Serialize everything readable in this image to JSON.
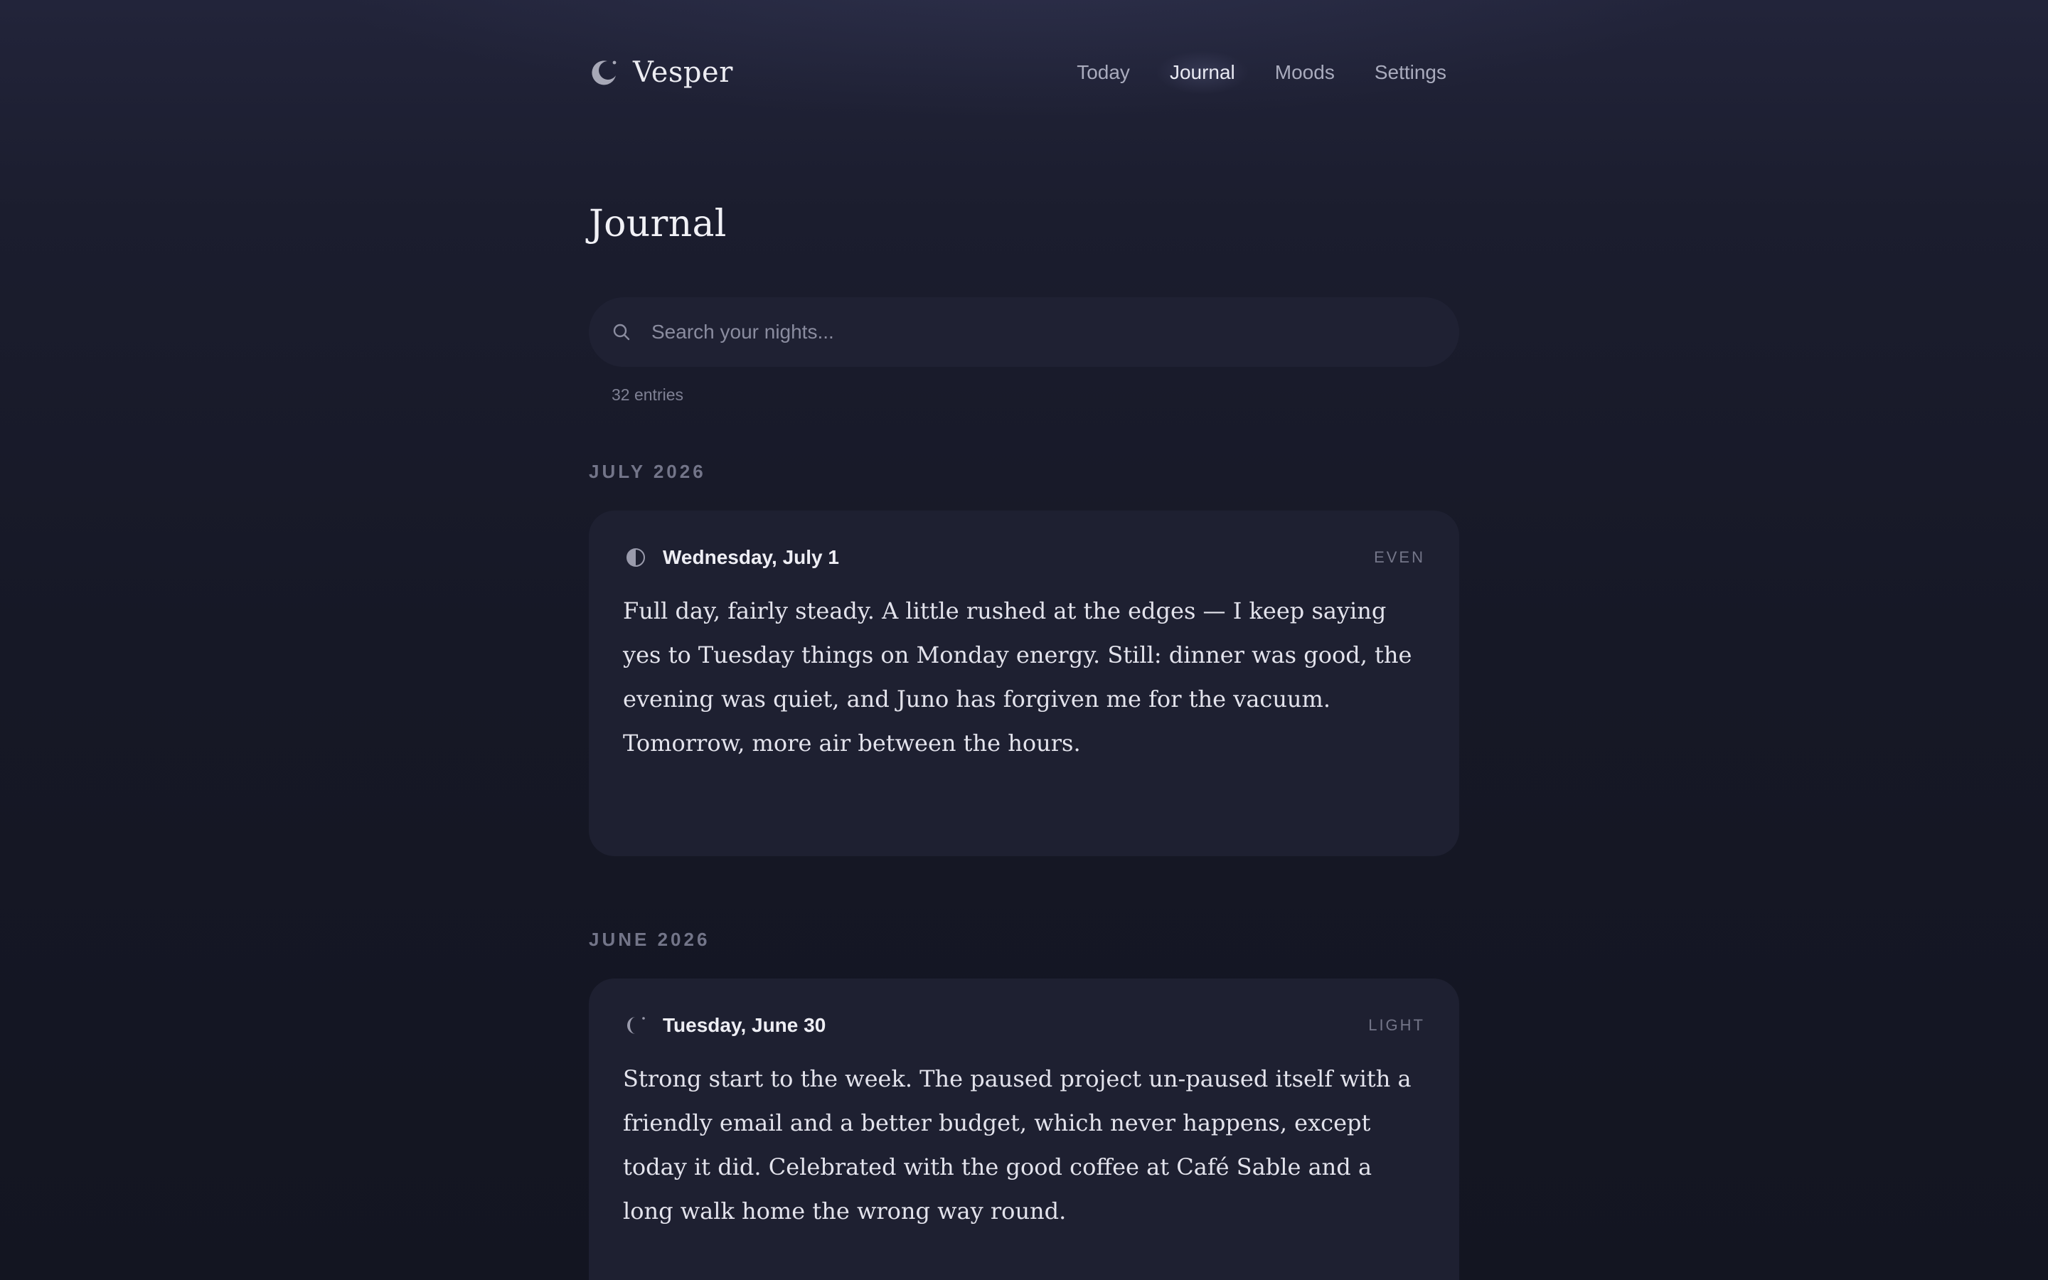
{
  "header": {
    "brand": "Vesper",
    "nav": [
      {
        "label": "Today",
        "active": false
      },
      {
        "label": "Journal",
        "active": true
      },
      {
        "label": "Moods",
        "active": false
      },
      {
        "label": "Settings",
        "active": false
      }
    ]
  },
  "page": {
    "title": "Journal"
  },
  "search": {
    "placeholder": "Search your nights...",
    "value": ""
  },
  "entry_count": "32 entries",
  "groups": [
    {
      "month": "JULY 2026",
      "entries": [
        {
          "date": "Wednesday, July 1",
          "mood": "EVEN",
          "icon": "half-moon-icon",
          "text": "Full day, fairly steady. A little rushed at the edges — I keep saying yes to Tuesday things on Monday energy. Still: dinner was good, the evening was quiet, and Juno has forgiven me for the vacuum. Tomorrow, more air between the hours."
        }
      ]
    },
    {
      "month": "JUNE 2026",
      "entries": [
        {
          "date": "Tuesday, June 30",
          "mood": "LIGHT",
          "icon": "crescent-moon-icon",
          "text": "Strong start to the week. The paused project un-paused itself with a friendly email and a better budget, which never happens, except today it did. Celebrated with the good coffee at Café Sable and a long walk home the wrong way round."
        }
      ]
    }
  ],
  "colors": {
    "background": "#161826",
    "card": "#1e2031",
    "text": "#e3e3ec",
    "muted": "#737589"
  }
}
